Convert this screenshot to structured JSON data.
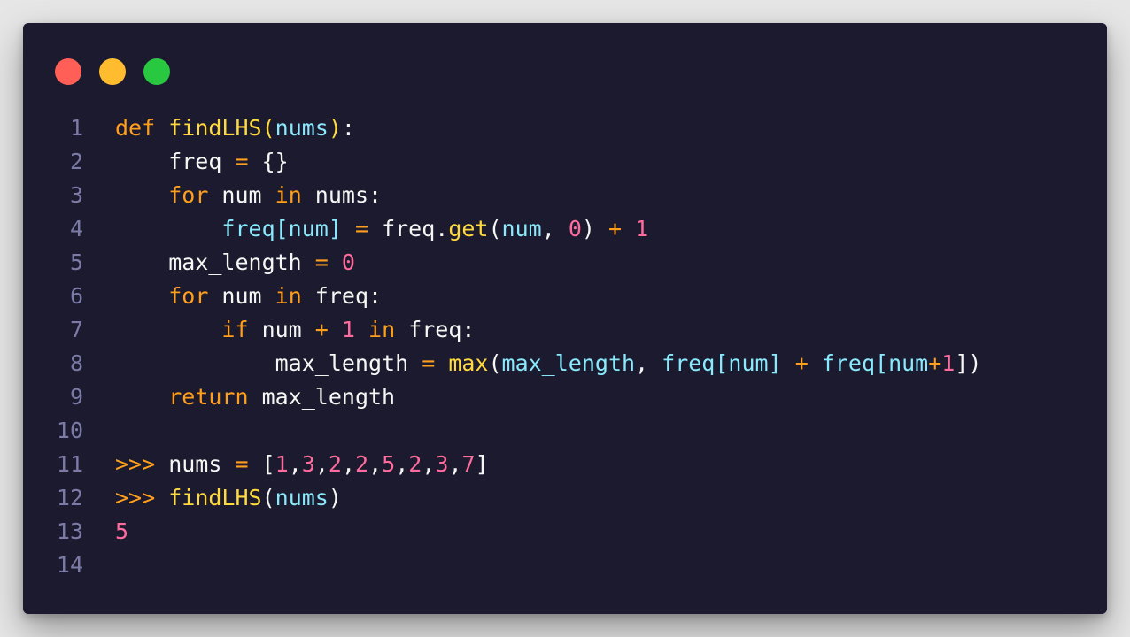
{
  "window": {
    "background": "#1b1a2e",
    "controls": [
      {
        "name": "close-dot",
        "color": "#ff5f57"
      },
      {
        "name": "minimize-dot",
        "color": "#febc2e"
      },
      {
        "name": "maximize-dot",
        "color": "#28c840"
      }
    ]
  },
  "colors": {
    "plain": "#f6f6f4",
    "keyword": "#ff9f1c",
    "function": "#ffd93d",
    "param": "#8be9fd",
    "number": "#ff6b9d",
    "line_number": "#7c7ba8"
  },
  "code": {
    "lines": [
      {
        "n": "1",
        "tokens": [
          {
            "t": "def",
            "c": "keyword"
          },
          {
            "t": " ",
            "c": "plain"
          },
          {
            "t": "findLHS",
            "c": "function"
          },
          {
            "t": "(",
            "c": "function"
          },
          {
            "t": "nums",
            "c": "param"
          },
          {
            "t": ")",
            "c": "function"
          },
          {
            "t": ":",
            "c": "plain"
          }
        ]
      },
      {
        "n": "2",
        "tokens": [
          {
            "t": "    freq ",
            "c": "plain"
          },
          {
            "t": "=",
            "c": "keyword"
          },
          {
            "t": " {}",
            "c": "plain"
          }
        ]
      },
      {
        "n": "3",
        "tokens": [
          {
            "t": "    ",
            "c": "plain"
          },
          {
            "t": "for",
            "c": "keyword"
          },
          {
            "t": " num ",
            "c": "plain"
          },
          {
            "t": "in",
            "c": "keyword"
          },
          {
            "t": " nums:",
            "c": "plain"
          }
        ]
      },
      {
        "n": "4",
        "tokens": [
          {
            "t": "        ",
            "c": "plain"
          },
          {
            "t": "freq[num]",
            "c": "param"
          },
          {
            "t": " ",
            "c": "plain"
          },
          {
            "t": "=",
            "c": "keyword"
          },
          {
            "t": " freq.",
            "c": "plain"
          },
          {
            "t": "get",
            "c": "function"
          },
          {
            "t": "(",
            "c": "plain"
          },
          {
            "t": "num",
            "c": "param"
          },
          {
            "t": ", ",
            "c": "plain"
          },
          {
            "t": "0",
            "c": "number"
          },
          {
            "t": ") ",
            "c": "plain"
          },
          {
            "t": "+",
            "c": "keyword"
          },
          {
            "t": " ",
            "c": "plain"
          },
          {
            "t": "1",
            "c": "number"
          }
        ]
      },
      {
        "n": "5",
        "tokens": [
          {
            "t": "    max_length ",
            "c": "plain"
          },
          {
            "t": "=",
            "c": "keyword"
          },
          {
            "t": " ",
            "c": "plain"
          },
          {
            "t": "0",
            "c": "number"
          }
        ]
      },
      {
        "n": "6",
        "tokens": [
          {
            "t": "    ",
            "c": "plain"
          },
          {
            "t": "for",
            "c": "keyword"
          },
          {
            "t": " num ",
            "c": "plain"
          },
          {
            "t": "in",
            "c": "keyword"
          },
          {
            "t": " freq:",
            "c": "plain"
          }
        ]
      },
      {
        "n": "7",
        "tokens": [
          {
            "t": "        ",
            "c": "plain"
          },
          {
            "t": "if",
            "c": "keyword"
          },
          {
            "t": " num ",
            "c": "plain"
          },
          {
            "t": "+",
            "c": "keyword"
          },
          {
            "t": " ",
            "c": "plain"
          },
          {
            "t": "1",
            "c": "number"
          },
          {
            "t": " ",
            "c": "plain"
          },
          {
            "t": "in",
            "c": "keyword"
          },
          {
            "t": " freq:",
            "c": "plain"
          }
        ]
      },
      {
        "n": "8",
        "tokens": [
          {
            "t": "            max_length ",
            "c": "plain"
          },
          {
            "t": "=",
            "c": "keyword"
          },
          {
            "t": " ",
            "c": "plain"
          },
          {
            "t": "max",
            "c": "function"
          },
          {
            "t": "(",
            "c": "plain"
          },
          {
            "t": "max_length",
            "c": "param"
          },
          {
            "t": ", ",
            "c": "plain"
          },
          {
            "t": "freq[num]",
            "c": "param"
          },
          {
            "t": " ",
            "c": "plain"
          },
          {
            "t": "+",
            "c": "keyword"
          },
          {
            "t": " ",
            "c": "plain"
          },
          {
            "t": "freq[num",
            "c": "param"
          },
          {
            "t": "+",
            "c": "keyword"
          },
          {
            "t": "1",
            "c": "number"
          },
          {
            "t": "])",
            "c": "plain"
          }
        ]
      },
      {
        "n": "9",
        "tokens": [
          {
            "t": "    ",
            "c": "plain"
          },
          {
            "t": "return",
            "c": "keyword"
          },
          {
            "t": " max_length",
            "c": "plain"
          }
        ]
      },
      {
        "n": "10",
        "tokens": []
      },
      {
        "n": "11",
        "tokens": [
          {
            "t": ">>>",
            "c": "keyword"
          },
          {
            "t": " nums ",
            "c": "plain"
          },
          {
            "t": "=",
            "c": "keyword"
          },
          {
            "t": " [",
            "c": "plain"
          },
          {
            "t": "1",
            "c": "number"
          },
          {
            "t": ",",
            "c": "plain"
          },
          {
            "t": "3",
            "c": "number"
          },
          {
            "t": ",",
            "c": "plain"
          },
          {
            "t": "2",
            "c": "number"
          },
          {
            "t": ",",
            "c": "plain"
          },
          {
            "t": "2",
            "c": "number"
          },
          {
            "t": ",",
            "c": "plain"
          },
          {
            "t": "5",
            "c": "number"
          },
          {
            "t": ",",
            "c": "plain"
          },
          {
            "t": "2",
            "c": "number"
          },
          {
            "t": ",",
            "c": "plain"
          },
          {
            "t": "3",
            "c": "number"
          },
          {
            "t": ",",
            "c": "plain"
          },
          {
            "t": "7",
            "c": "number"
          },
          {
            "t": "]",
            "c": "plain"
          }
        ]
      },
      {
        "n": "12",
        "tokens": [
          {
            "t": ">>>",
            "c": "keyword"
          },
          {
            "t": " ",
            "c": "plain"
          },
          {
            "t": "findLHS",
            "c": "function"
          },
          {
            "t": "(",
            "c": "plain"
          },
          {
            "t": "nums",
            "c": "param"
          },
          {
            "t": ")",
            "c": "plain"
          }
        ]
      },
      {
        "n": "13",
        "tokens": [
          {
            "t": "5",
            "c": "number"
          }
        ]
      },
      {
        "n": "14",
        "tokens": []
      }
    ]
  }
}
